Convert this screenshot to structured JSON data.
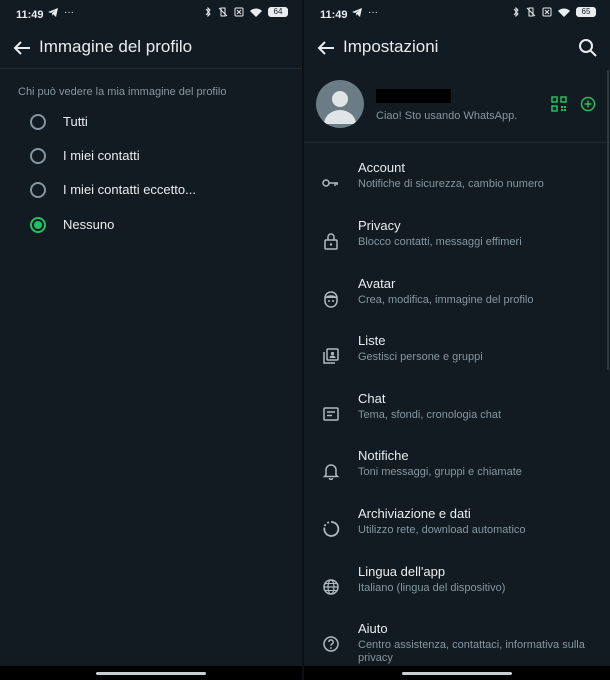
{
  "status_bar": {
    "time": "11:49",
    "left_battery": "64",
    "right_battery": "65"
  },
  "left_screen": {
    "title": "Immagine del profilo",
    "section_label": "Chi può vedere la mia immagine del profilo",
    "options": [
      {
        "label": "Tutti",
        "checked": false
      },
      {
        "label": "I miei contatti",
        "checked": false
      },
      {
        "label": "I miei contatti eccetto...",
        "checked": false
      },
      {
        "label": "Nessuno",
        "checked": true
      }
    ]
  },
  "right_screen": {
    "title": "Impostazioni",
    "profile": {
      "status": "Ciao! Sto usando WhatsApp."
    },
    "menu": [
      {
        "icon": "key-icon",
        "title": "Account",
        "subtitle": "Notifiche di sicurezza, cambio numero"
      },
      {
        "icon": "lock-icon",
        "title": "Privacy",
        "subtitle": "Blocco contatti, messaggi effimeri"
      },
      {
        "icon": "avatar-face-icon",
        "title": "Avatar",
        "subtitle": "Crea, modifica, immagine del profilo"
      },
      {
        "icon": "lists-icon",
        "title": "Liste",
        "subtitle": "Gestisci persone e gruppi"
      },
      {
        "icon": "chat-icon",
        "title": "Chat",
        "subtitle": "Tema, sfondi, cronologia chat"
      },
      {
        "icon": "bell-icon",
        "title": "Notifiche",
        "subtitle": "Toni messaggi, gruppi e chiamate"
      },
      {
        "icon": "storage-icon",
        "title": "Archiviazione e dati",
        "subtitle": "Utilizzo rete, download automatico"
      },
      {
        "icon": "globe-icon",
        "title": "Lingua dell'app",
        "subtitle": "Italiano (lingua del dispositivo)"
      },
      {
        "icon": "help-icon",
        "title": "Aiuto",
        "subtitle": "Centro assistenza, contattaci, informativa sulla privacy"
      }
    ]
  },
  "colors": {
    "background": "#121b22",
    "accent": "#21c063",
    "secondary_text": "#8696a0"
  }
}
